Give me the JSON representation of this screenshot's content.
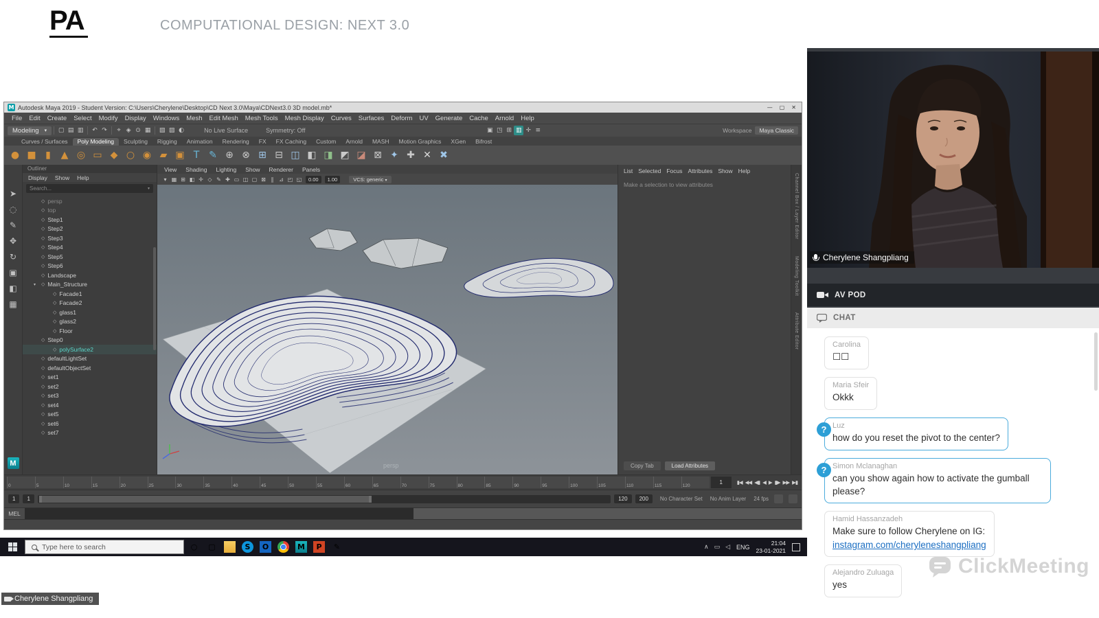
{
  "header": {
    "logo_text": "PA",
    "title": "COMPUTATIONAL DESIGN: NEXT 3.0"
  },
  "presenter_badge": {
    "name": "Cherylene Shangpliang"
  },
  "maya": {
    "titlebar": {
      "logo_glyph": "M",
      "title": "Autodesk Maya 2019 - Student Version: C:\\Users\\Cherylene\\Desktop\\CD Next 3.0\\Maya\\CDNext3.0 3D model.mb*",
      "minimize": "—",
      "maximize": "▢",
      "close": "✕"
    },
    "menubar": {
      "items": [
        "File",
        "Edit",
        "Create",
        "Select",
        "Modify",
        "Display",
        "Windows",
        "Mesh",
        "Edit Mesh",
        "Mesh Tools",
        "Mesh Display",
        "Curves",
        "Surfaces",
        "Deform",
        "UV",
        "Generate",
        "Cache",
        "Arnold",
        "Help"
      ],
      "workspace_label": "Workspace",
      "workspace_value": "Maya Classic"
    },
    "statusline": {
      "mode": "Modeling",
      "icons": [
        {
          "g": "▢"
        },
        {
          "g": "▤"
        },
        {
          "g": "▥"
        },
        {
          "sep": 1
        },
        {
          "g": "↶"
        },
        {
          "g": "↷"
        },
        {
          "sep": 1
        },
        {
          "g": "⌖"
        },
        {
          "g": "◈"
        },
        {
          "g": "⊙"
        },
        {
          "g": "▦"
        },
        {
          "sep": 1
        },
        {
          "g": "▧"
        },
        {
          "g": "▨"
        },
        {
          "g": "◐"
        }
      ],
      "no_live_surface": "No Live Surface",
      "symmetry": "Symmetry: Off",
      "right_icons": [
        {
          "g": "▣"
        },
        {
          "g": "◳"
        },
        {
          "g": "⊞"
        },
        {
          "g": "▥",
          "hl": 1
        },
        {
          "g": "✛"
        },
        {
          "g": "≡"
        }
      ]
    },
    "shelf": {
      "tabs": [
        {
          "label": "Curves / Surfaces"
        },
        {
          "label": "Poly Modeling",
          "active": true
        },
        {
          "label": "Sculpting"
        },
        {
          "label": "Rigging"
        },
        {
          "label": "Animation"
        },
        {
          "label": "Rendering"
        },
        {
          "label": "FX"
        },
        {
          "label": "FX Caching"
        },
        {
          "label": "Custom"
        },
        {
          "label": "Arnold"
        },
        {
          "label": "MASH"
        },
        {
          "label": "Motion Graphics"
        },
        {
          "label": "XGen"
        },
        {
          "label": "Bifrost"
        }
      ],
      "icons": [
        {
          "g": "●",
          "c": "#d3913b"
        },
        {
          "g": "■",
          "c": "#d3913b"
        },
        {
          "g": "▮",
          "c": "#d3913b"
        },
        {
          "g": "▲",
          "c": "#d3913b"
        },
        {
          "g": "◎",
          "c": "#d3913b"
        },
        {
          "g": "▭",
          "c": "#d3913b"
        },
        {
          "g": "◆",
          "c": "#d3913b"
        },
        {
          "g": "○",
          "c": "#d3913b"
        },
        {
          "g": "◉",
          "c": "#d3913b"
        },
        {
          "g": "▰",
          "c": "#d3913b"
        },
        {
          "g": "▣",
          "c": "#d3913b"
        },
        {
          "g": "T",
          "c": "#69b7d9"
        },
        {
          "g": "✎",
          "c": "#69b7d9"
        },
        {
          "g": "⊕",
          "c": "#c9c9c9"
        },
        {
          "g": "⊗",
          "c": "#c9c9c9"
        },
        {
          "g": "⊞",
          "c": "#9fc6e8"
        },
        {
          "g": "⊟",
          "c": "#c9c9c9"
        },
        {
          "g": "◫",
          "c": "#9fc6e8"
        },
        {
          "g": "◧",
          "c": "#c9c9c9"
        },
        {
          "g": "◨",
          "c": "#8fbf8a"
        },
        {
          "g": "◩",
          "c": "#c9c9c9"
        },
        {
          "g": "◪",
          "c": "#c98a7a"
        },
        {
          "g": "⊠",
          "c": "#c9c9c9"
        },
        {
          "g": "✦",
          "c": "#9fc6e8"
        },
        {
          "g": "✚",
          "c": "#c9c9c9"
        },
        {
          "g": "✕",
          "c": "#d9d9d9"
        },
        {
          "g": "✖",
          "c": "#9fc6e8"
        }
      ]
    },
    "toolbox": {
      "icons": [
        {
          "g": "➤"
        },
        {
          "g": "◌"
        },
        {
          "g": "✎"
        },
        {
          "g": "✥"
        },
        {
          "g": "↻"
        },
        {
          "g": "▣"
        },
        {
          "g": "◧"
        },
        {
          "g": "▦"
        }
      ],
      "logo": "M"
    },
    "outliner": {
      "panel_tab": "Outliner",
      "menu": [
        "Display",
        "Show",
        "Help"
      ],
      "search_placeholder": "Search...",
      "items": [
        {
          "label": "persp",
          "dim": true
        },
        {
          "label": "top",
          "dim": true
        },
        {
          "label": "Step1"
        },
        {
          "label": "Step2"
        },
        {
          "label": "Step3"
        },
        {
          "label": "Step4"
        },
        {
          "label": "Step5"
        },
        {
          "label": "Step6"
        },
        {
          "label": "Landscape"
        },
        {
          "label": "Main_Structure",
          "exp": true
        },
        {
          "label": "Facade1",
          "ind": true
        },
        {
          "label": "Facade2",
          "ind": true
        },
        {
          "label": "glass1",
          "ind": true
        },
        {
          "label": "glass2",
          "ind": true
        },
        {
          "label": "Floor",
          "ind": true
        },
        {
          "label": "Step0"
        },
        {
          "label": "polySurface2",
          "ind": true,
          "sel": true
        },
        {
          "label": "defaultLightSet"
        },
        {
          "label": "defaultObjectSet"
        },
        {
          "label": "set1"
        },
        {
          "label": "set2"
        },
        {
          "label": "set3"
        },
        {
          "label": "set4"
        },
        {
          "label": "set5"
        },
        {
          "label": "set6"
        },
        {
          "label": "set7"
        }
      ]
    },
    "panel": {
      "menu": [
        "View",
        "Shading",
        "Lighting",
        "Show",
        "Renderer",
        "Panels"
      ],
      "icons": [
        {
          "g": "▾"
        },
        {
          "g": "▦"
        },
        {
          "g": "⊞"
        },
        {
          "g": "◧"
        },
        {
          "g": "✛"
        },
        {
          "g": "◇"
        },
        {
          "g": "✎"
        },
        {
          "g": "✚"
        },
        {
          "g": "▭"
        },
        {
          "g": "◫"
        },
        {
          "g": "▢"
        },
        {
          "g": "⊠"
        },
        {
          "g": "∥"
        },
        {
          "g": "⊿"
        },
        {
          "g": "◰"
        },
        {
          "g": "◱"
        }
      ],
      "field1": "0.00",
      "field2": "1.00",
      "dropdown": "VCS: generic",
      "camera_label": "persp"
    },
    "attr": {
      "menu": [
        "List",
        "Selected",
        "Focus",
        "Attributes",
        "Show",
        "Help"
      ],
      "hint": "Make a selection to view attributes",
      "buttons": [
        {
          "label": "Copy Tab"
        },
        {
          "label": "Load Attributes",
          "primary": true
        }
      ]
    },
    "sidestrip": {
      "labels": [
        "Channel Box / Layer Editor",
        "Modeling Toolkit",
        "Attribute Editor"
      ]
    },
    "timeline": {
      "ticks": [
        "0",
        "5",
        "10",
        "15",
        "20",
        "25",
        "30",
        "35",
        "40",
        "45",
        "50",
        "55",
        "60",
        "65",
        "70",
        "75",
        "80",
        "85",
        "90",
        "95",
        "100",
        "105",
        "110",
        "115",
        "120"
      ],
      "current": "1",
      "controls": [
        {
          "g": "▮◀"
        },
        {
          "g": "◀◀"
        },
        {
          "g": "◀▮"
        },
        {
          "g": "◀"
        },
        {
          "g": "▶"
        },
        {
          "g": "▮▶"
        },
        {
          "g": "▶▶"
        },
        {
          "g": "▶▮"
        }
      ]
    },
    "range": {
      "fields_left": [
        "1",
        "1"
      ],
      "fields_right": [
        "120",
        "200"
      ],
      "character": "No Character Set",
      "anim_layer": "No Anim Layer",
      "fps": "24 fps"
    },
    "cmdline": {
      "label": "MEL"
    }
  },
  "taskbar": {
    "search_placeholder": "Type here to search",
    "apps": [
      {
        "name": "cortana",
        "g": "○",
        "fg": "#d9d9d9"
      },
      {
        "name": "task-view",
        "g": "▢",
        "fg": "#d9d9d9"
      },
      {
        "name": "file-explorer",
        "g": "",
        "bg": "linear-gradient(180deg,#f7cf63,#e8ae3a)",
        "fg": "#b07c14"
      },
      {
        "name": "skype",
        "g": "S",
        "bg": "#0d96dd",
        "fg": "#ffffff",
        "round": 1
      },
      {
        "name": "outlook",
        "g": "O",
        "bg": "#1565c0",
        "fg": "#ffffff"
      },
      {
        "name": "chrome",
        "g": "",
        "bg": "radial-gradient(circle,#4285f4 0 30%,#ffffff 30% 38%,rgba(255,255,255,0) 38%),conic-gradient(#ea4335 0 33%,#fbbc05 33% 66%,#34a853 66% 100%)",
        "round": 1
      },
      {
        "name": "maya",
        "g": "M",
        "bg": "linear-gradient(180deg,#1ab5be,#0b7f8d)",
        "fg": "#ffffff"
      },
      {
        "name": "powerpoint",
        "g": "P",
        "bg": "#d04423",
        "fg": "#ffffff"
      },
      {
        "name": "pen",
        "g": "✎",
        "fg": "#e0e0e0"
      }
    ],
    "tray_icons": [
      {
        "g": "∧"
      },
      {
        "g": "▭"
      },
      {
        "g": "◁"
      }
    ],
    "lang": "ENG",
    "time": "21:04",
    "date": "23-01-2021"
  },
  "sidebar": {
    "webcam_name": "Cherylene Shangpliang",
    "av_pod_label": "AV POD",
    "chat_label": "CHAT",
    "question_glyph": "?",
    "messages": [
      {
        "author": "Carolina",
        "text": "☐☐"
      },
      {
        "author": "Maria Sfeir",
        "text": "Okkk"
      },
      {
        "author": "Luz",
        "text": "how do you reset the pivot to the center?",
        "question": true
      },
      {
        "author": "Simon Mclanaghan",
        "text": "can you show again how to activate the gumball please?",
        "question": true
      },
      {
        "author": "Hamid Hassanzadeh",
        "text": "Make sure to follow Cherylene on IG:",
        "link": "instagram.com/cheryleneshangpliang"
      },
      {
        "author": "Alejandro Zuluaga",
        "text": "yes"
      }
    ],
    "watermark": "ClickMeeting"
  }
}
